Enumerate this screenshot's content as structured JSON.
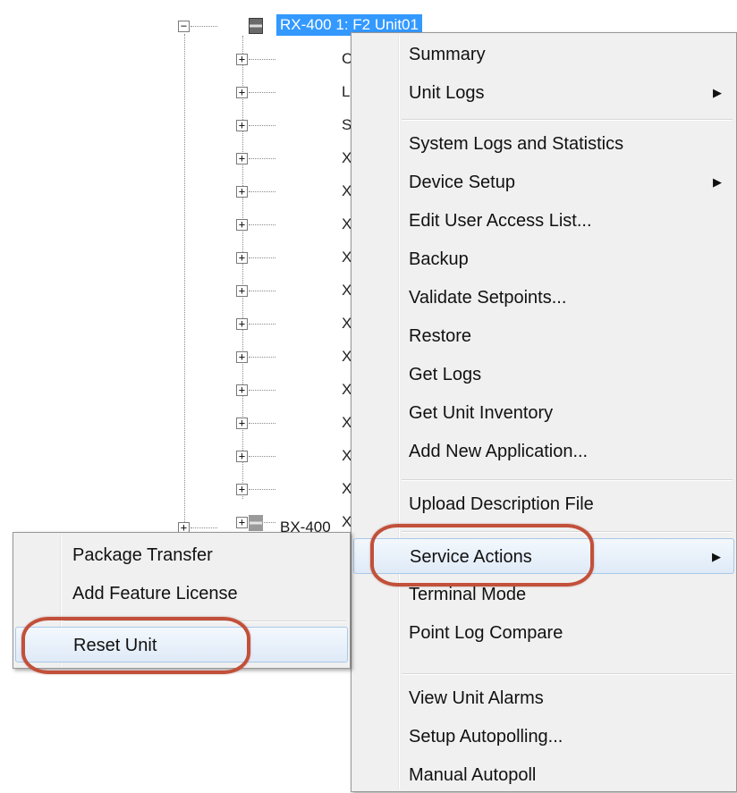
{
  "tree": {
    "selected_node": "RX-400 1: F2 Unit01",
    "sibling_node": "BX-400",
    "child_prefixes": [
      "C",
      "L",
      "S",
      "X",
      "X",
      "X",
      "X",
      "X",
      "X",
      "X",
      "X",
      "X",
      "X",
      "X",
      "X"
    ],
    "expander_collapsed": "+",
    "expander_expanded": "−"
  },
  "context_menu": {
    "items": [
      {
        "label": "Summary",
        "submenu": false
      },
      {
        "label": "Unit Logs",
        "submenu": true
      },
      {
        "label": "System Logs and Statistics",
        "submenu": false
      },
      {
        "label": "Device Setup",
        "submenu": true
      },
      {
        "label": "Edit User Access List...",
        "submenu": false
      },
      {
        "label": "Backup",
        "submenu": false
      },
      {
        "label": "Validate Setpoints...",
        "submenu": false
      },
      {
        "label": "Restore",
        "submenu": false
      },
      {
        "label": "Get Logs",
        "submenu": false
      },
      {
        "label": "Get Unit Inventory",
        "submenu": false
      },
      {
        "label": "Add New Application...",
        "submenu": false
      },
      {
        "label": "Upload Description File",
        "submenu": false
      },
      {
        "label": "Service Actions",
        "submenu": true
      },
      {
        "label": "Terminal Mode",
        "submenu": false
      },
      {
        "label": "Point Log Compare",
        "submenu": false
      },
      {
        "label": "View Unit Alarms",
        "submenu": false
      },
      {
        "label": "Setup Autopolling...",
        "submenu": false
      },
      {
        "label": "Manual Autopoll",
        "submenu": false
      }
    ],
    "submenu_arrow": "▶"
  },
  "service_submenu": {
    "items": [
      {
        "label": "Package Transfer"
      },
      {
        "label": "Add Feature License"
      },
      {
        "label": "Reset Unit"
      }
    ]
  },
  "colors": {
    "selection": "#3399ff",
    "annotation_ring": "#c2503a",
    "menu_bg": "#f0f0f0"
  }
}
